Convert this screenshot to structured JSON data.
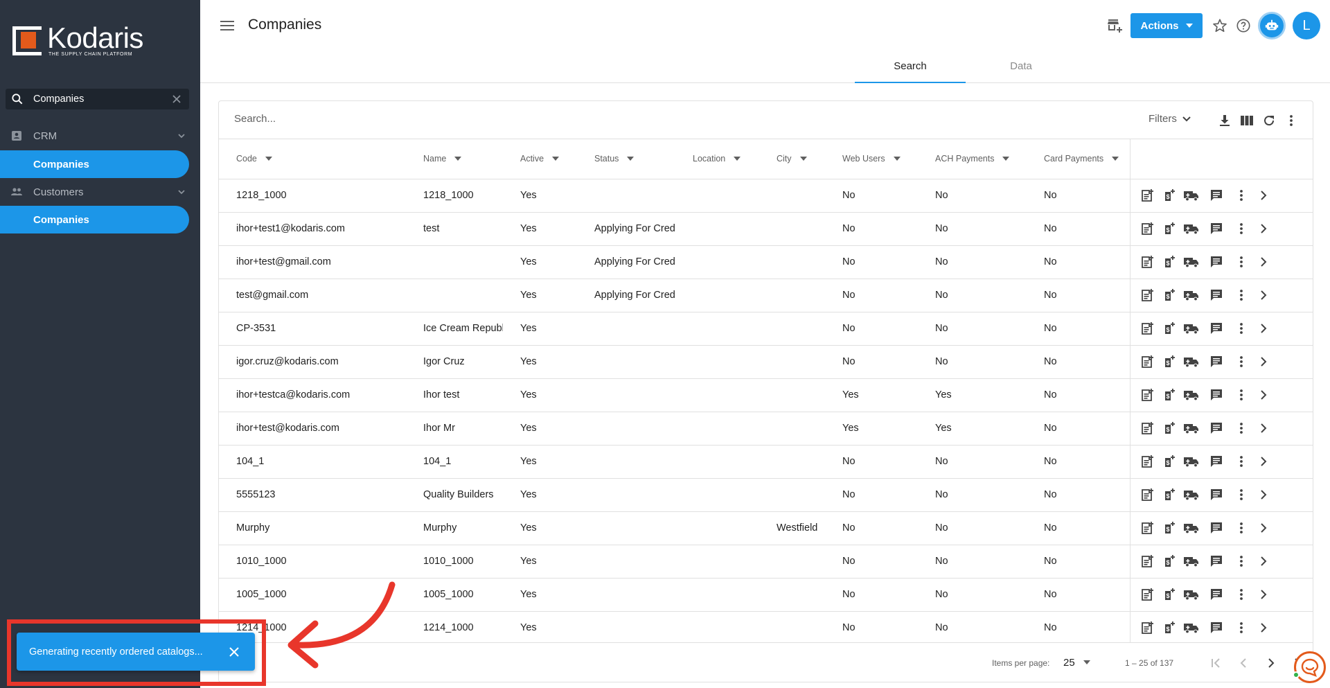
{
  "app": {
    "logo_name": "Kodaris",
    "logo_tagline": "THE SUPPLY CHAIN PLATFORM",
    "brand_color": "#1c96e8",
    "sidebar_color": "#2c3440"
  },
  "sidebar": {
    "search_value": "Companies",
    "groups": [
      {
        "label": "CRM",
        "icon": "contact-card-icon",
        "items": [
          {
            "label": "Companies"
          }
        ]
      },
      {
        "label": "Customers",
        "icon": "people-icon",
        "items": [
          {
            "label": "Companies"
          }
        ]
      }
    ]
  },
  "header": {
    "title": "Companies",
    "actions_label": "Actions",
    "avatar_initial": "L",
    "icons": [
      "store-add-icon",
      "star-icon",
      "help-icon",
      "robot-icon"
    ]
  },
  "tabs": [
    {
      "label": "Search",
      "active": true
    },
    {
      "label": "Data",
      "active": false
    }
  ],
  "table": {
    "search_placeholder": "Search...",
    "filters_label": "Filters",
    "columns": [
      "Code",
      "Name",
      "Active",
      "Status",
      "Location",
      "City",
      "Web Users",
      "ACH Payments",
      "Card Payments"
    ],
    "rows": [
      [
        "1218_1000",
        "1218_1000",
        "Yes",
        "",
        "",
        "",
        "No",
        "No",
        "No"
      ],
      [
        "ihor+test1@kodaris.com",
        "test",
        "Yes",
        "Applying For Credit",
        "",
        "",
        "No",
        "No",
        "No"
      ],
      [
        "ihor+test@gmail.com",
        "",
        "Yes",
        "Applying For Credit",
        "",
        "",
        "No",
        "No",
        "No"
      ],
      [
        "test@gmail.com",
        "",
        "Yes",
        "Applying For Credit",
        "",
        "",
        "No",
        "No",
        "No"
      ],
      [
        "CP-3531",
        "Ice Cream Republic",
        "Yes",
        "",
        "",
        "",
        "No",
        "No",
        "No"
      ],
      [
        "igor.cruz@kodaris.com",
        "Igor Cruz",
        "Yes",
        "",
        "",
        "",
        "No",
        "No",
        "No"
      ],
      [
        "ihor+testca@kodaris.com",
        "Ihor test",
        "Yes",
        "",
        "",
        "",
        "Yes",
        "Yes",
        "No"
      ],
      [
        "ihor+test@kodaris.com",
        "Ihor Mr",
        "Yes",
        "",
        "",
        "",
        "Yes",
        "Yes",
        "No"
      ],
      [
        "104_1",
        "104_1",
        "Yes",
        "",
        "",
        "",
        "No",
        "No",
        "No"
      ],
      [
        "5555123",
        "Quality Builders",
        "Yes",
        "",
        "",
        "",
        "No",
        "No",
        "No"
      ],
      [
        "Murphy",
        "Murphy",
        "Yes",
        "",
        "",
        "Westfield",
        "No",
        "No",
        "No"
      ],
      [
        "1010_1000",
        "1010_1000",
        "Yes",
        "",
        "",
        "",
        "No",
        "No",
        "No"
      ],
      [
        "1005_1000",
        "1005_1000",
        "Yes",
        "",
        "",
        "",
        "No",
        "No",
        "No"
      ],
      [
        "1214_1000",
        "1214_1000",
        "Yes",
        "",
        "",
        "",
        "No",
        "No",
        "No"
      ]
    ],
    "row_action_icons": [
      "new-order-icon",
      "payment-icon",
      "shipping-truck-icon",
      "comment-icon",
      "more-vert-icon",
      "chevron-right-icon"
    ]
  },
  "paginator": {
    "items_per_page_label": "Items per page:",
    "items_per_page": "25",
    "range_label": "1 – 25 of 137"
  },
  "snackbar": {
    "message": "Generating recently ordered catalogs...",
    "annotation_color": "#e8362b"
  }
}
